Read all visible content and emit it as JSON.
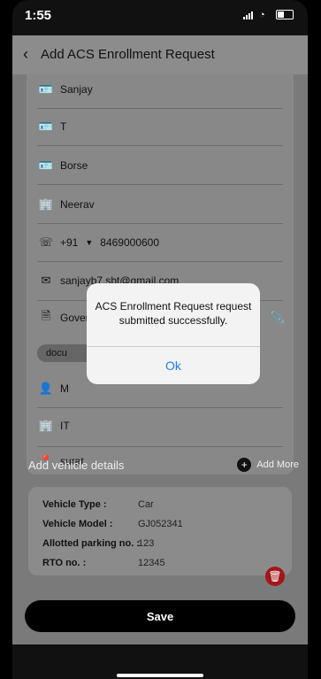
{
  "status_bar": {
    "time": "1:55"
  },
  "header": {
    "title": "Add ACS Enrollment Request"
  },
  "form": {
    "first_name": "Sanjay",
    "middle_name": "T",
    "last_name": "Borse",
    "company": "Neerav",
    "phone_code": "+91",
    "phone_number": "8469000600",
    "email": "sanjayb7.sbt@gmail.com",
    "government_id_label": "Government Id*",
    "document_chip": "docu",
    "person_partial": "M",
    "department_partial": "IT",
    "city": "surat"
  },
  "vehicle_section": {
    "title": "Add vehicle details",
    "add_more": "Add More"
  },
  "vehicle_details": [
    {
      "label": "Vehicle Type :",
      "value": "Car"
    },
    {
      "label": "Vehicle Model :",
      "value": "GJ052341"
    },
    {
      "label": "Allotted parking no. :",
      "value": "123"
    },
    {
      "label": "RTO no. :",
      "value": "12345"
    }
  ],
  "save_label": "Save",
  "alert": {
    "message": "ACS Enrollment Request request submitted successfully.",
    "ok_label": "Ok"
  }
}
